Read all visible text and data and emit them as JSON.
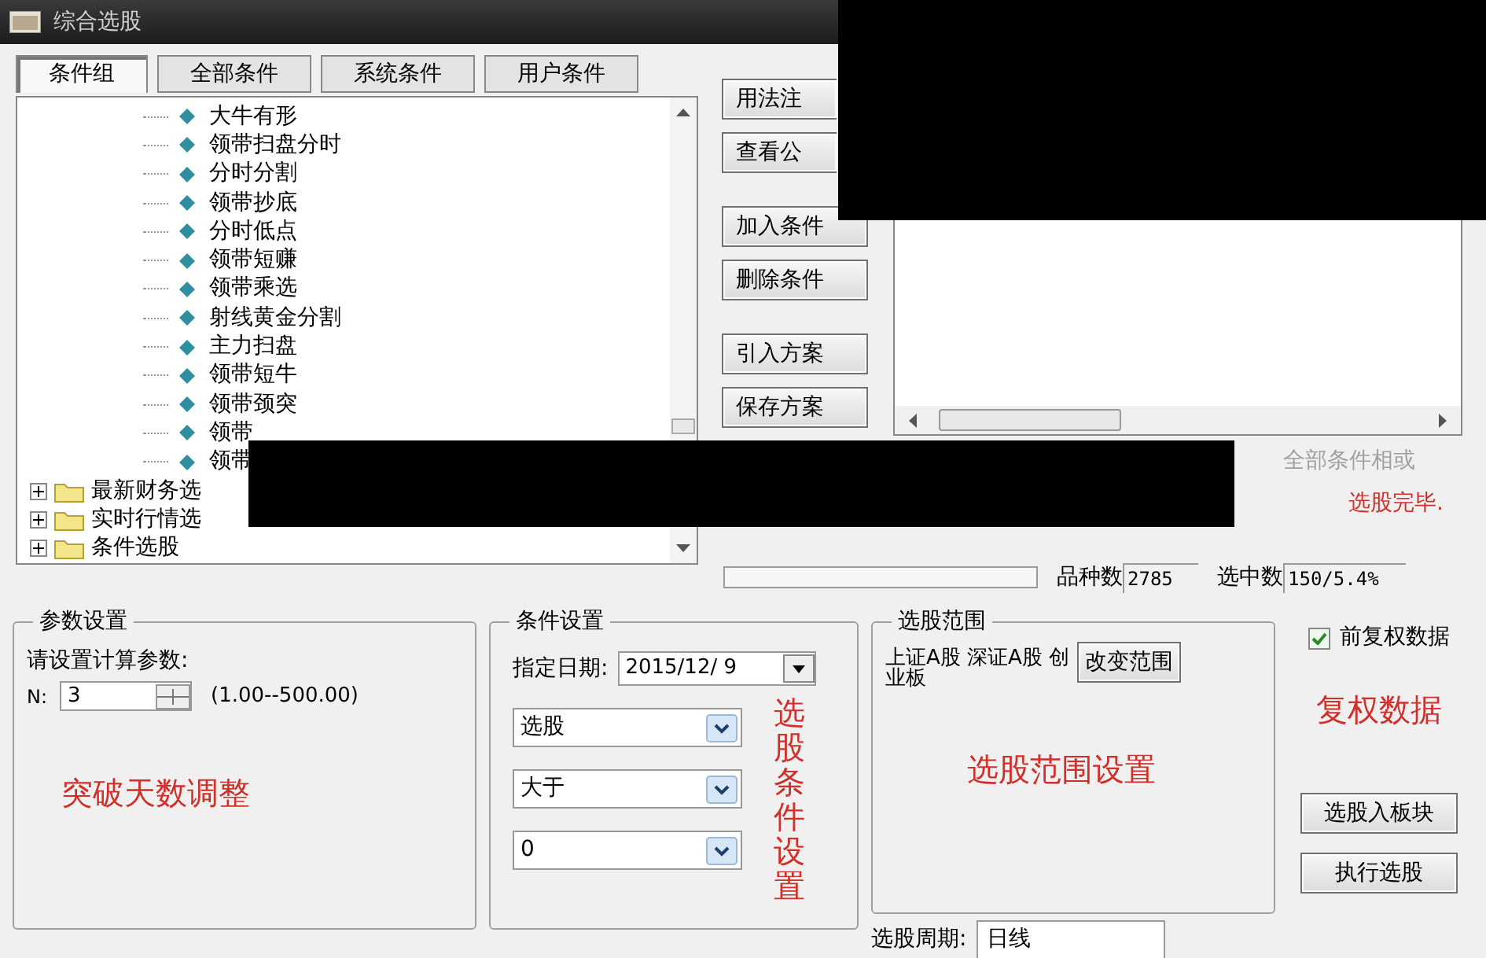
{
  "window": {
    "title": "综合选股"
  },
  "tabs": [
    {
      "label": "条件组",
      "selected": true
    },
    {
      "label": "全部条件",
      "selected": false
    },
    {
      "label": "系统条件",
      "selected": false
    },
    {
      "label": "用户条件",
      "selected": false
    }
  ],
  "tree": {
    "leaves": [
      "大牛有形",
      "领带扫盘分时",
      "分时分割",
      "领带抄底",
      "分时低点",
      "领带短赚",
      "领带乘选",
      "射线黄金分割",
      "主力扫盘",
      "领带短牛",
      "领带颈突",
      "领带",
      "领带"
    ],
    "groups": [
      {
        "label": "最新财务选",
        "expanded": false
      },
      {
        "label": "实时行情选",
        "expanded": false
      },
      {
        "label": "条件选股",
        "expanded": false
      }
    ]
  },
  "actions": [
    "用法注",
    "查看公",
    "加入条件",
    "删除条件",
    "引入方案",
    "保存方案"
  ],
  "conditions": {
    "or_label": "全部条件相或",
    "or_disabled": true,
    "status": "选股完毕."
  },
  "progress": {
    "level": 0
  },
  "stats": [
    {
      "label": "品种数",
      "value": "2785"
    },
    {
      "label": "选中数",
      "value": "150/5.4%"
    }
  ],
  "params": {
    "title": "参数设置",
    "prompt": "请设置计算参数:",
    "n_label": "N:",
    "n_value": "3",
    "range": "(1.00--500.00)",
    "note": "突破天数调整"
  },
  "condition_setup": {
    "title": "条件设置",
    "date_label": "指定日期:",
    "date": "2015/12/ 9",
    "selects": [
      "选股",
      "大于",
      "0"
    ],
    "note": "选股条件设置"
  },
  "stock_range": {
    "title": "选股范围",
    "markets": "上证A股 深证A股 创业板",
    "button": "改变范围",
    "note": "选股范围设置"
  },
  "adjust": {
    "label": "前复权数据",
    "checked": true,
    "note": "复权数据",
    "buttons": [
      "选股入板块",
      "执行选股"
    ]
  },
  "period": {
    "label": "选股周期:",
    "value": "日线"
  }
}
